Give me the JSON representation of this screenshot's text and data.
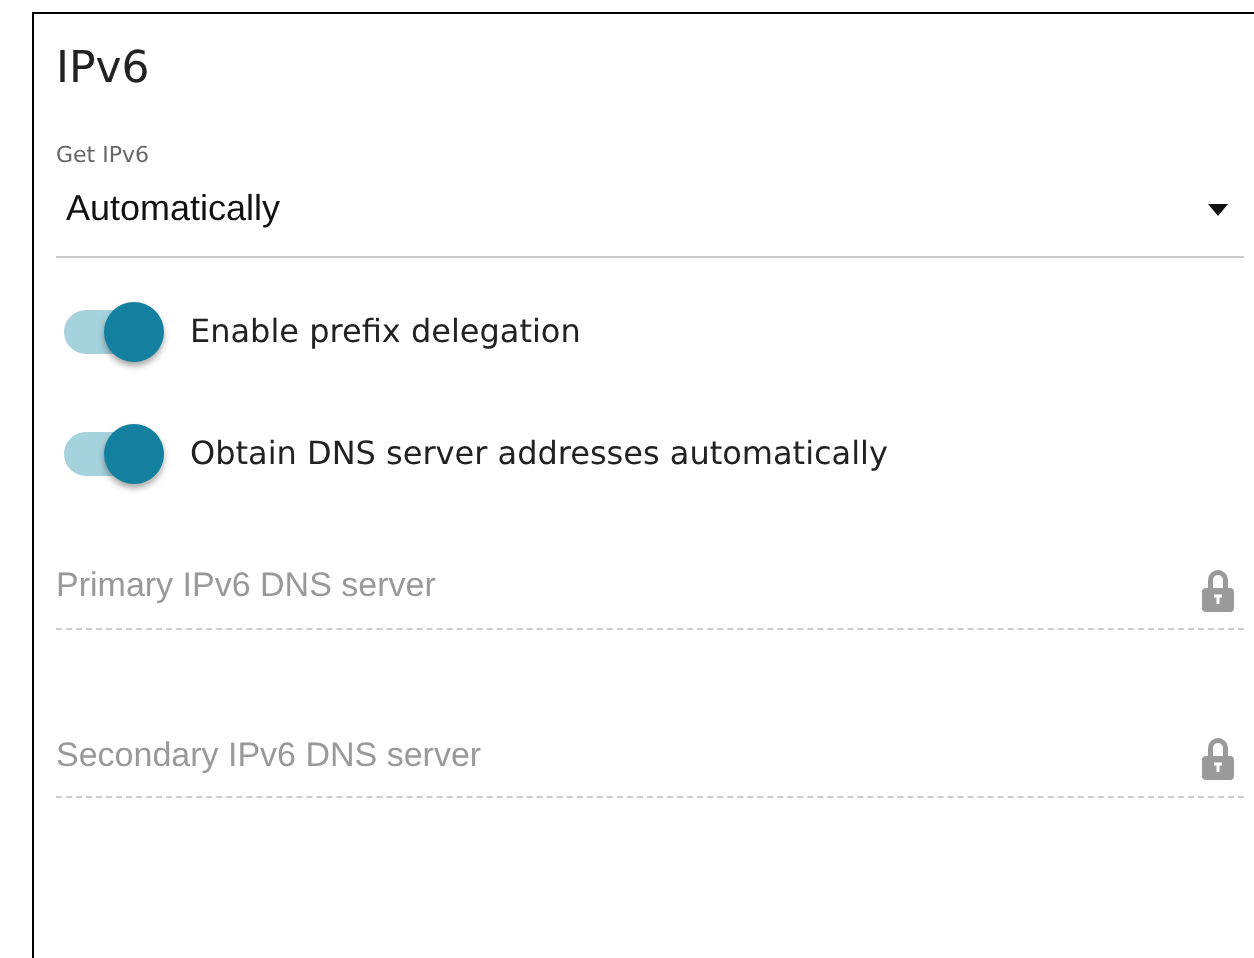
{
  "section": {
    "title": "IPv6"
  },
  "get_ipv6": {
    "label": "Get IPv6",
    "value": "Automatically"
  },
  "toggles": [
    {
      "label": "Enable prefix delegation",
      "on": true
    },
    {
      "label": "Obtain DNS server addresses automatically",
      "on": true
    }
  ],
  "fields": [
    {
      "placeholder": "Primary IPv6 DNS server",
      "disabled": true
    },
    {
      "placeholder": "Secondary IPv6 DNS server",
      "disabled": true
    }
  ]
}
